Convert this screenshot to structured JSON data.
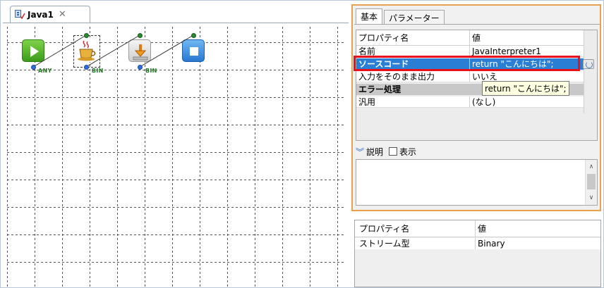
{
  "editor": {
    "tab_label": "Java1",
    "tab_close": "✕",
    "nodes": [
      {
        "name": "start",
        "port_label": "ANY"
      },
      {
        "name": "java-interpreter",
        "port_label": "BIN"
      },
      {
        "name": "drop",
        "port_label": "BIN"
      },
      {
        "name": "stop"
      }
    ]
  },
  "properties": {
    "tabs": [
      "基本",
      "パラメーター"
    ],
    "header": {
      "col1": "プロパティ名",
      "col2": "値"
    },
    "rows": [
      {
        "name": "名前",
        "value": "JavaInterpreter1"
      },
      {
        "name": "ソースコード",
        "value": "return \"こんにちは\";"
      },
      {
        "name": "入力をそのまま出力",
        "value": "いいえ"
      },
      {
        "name": "エラー処理",
        "value": ""
      },
      {
        "name": "汎用",
        "value": "(なし)"
      }
    ],
    "tooltip": "return \"こんにちは\";",
    "description_label": "説明",
    "show_label": "表示"
  },
  "lower": {
    "header": {
      "col1": "プロパティ名",
      "col2": "値"
    },
    "rows": [
      {
        "name": "ストリーム型",
        "value": "Binary"
      }
    ]
  },
  "colors": {
    "highlight": "#e8101a",
    "panel_border": "#e9a14f",
    "selection": "#2a7fd4"
  }
}
